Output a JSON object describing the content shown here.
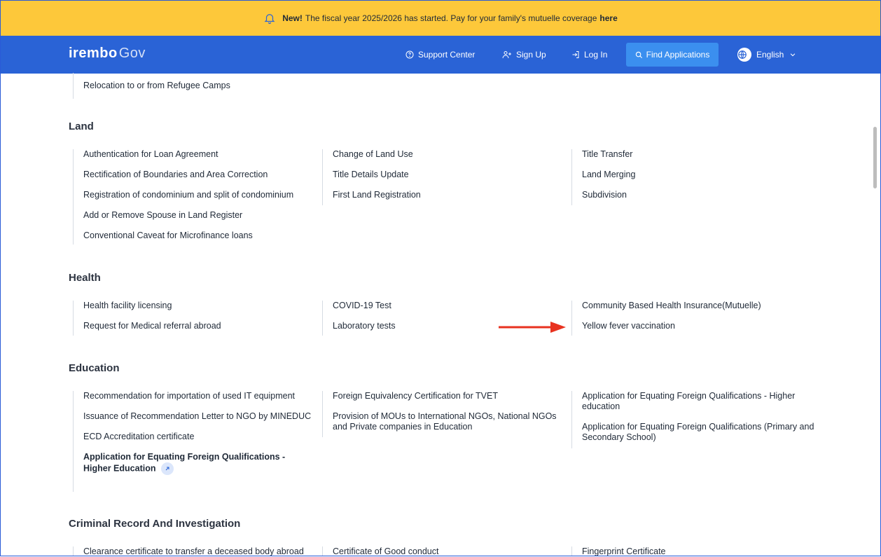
{
  "banner": {
    "new_label": "New!",
    "message": "The fiscal year 2025/2026 has started. Pay for your family's mutuelle coverage",
    "link_label": "here"
  },
  "nav": {
    "logo_main": "irembo",
    "logo_sub": "Gov",
    "support_label": "Support Center",
    "signup_label": "Sign Up",
    "login_label": "Log In",
    "find_label": "Find Applications",
    "language_label": "English"
  },
  "relocation": {
    "item": "Relocation to or from Refugee Camps"
  },
  "land": {
    "title": "Land",
    "col1": [
      "Authentication for Loan Agreement",
      "Rectification of Boundaries and Area Correction",
      "Registration of condominium and split of condominium",
      "Add or Remove Spouse in Land Register",
      "Conventional Caveat for Microfinance loans"
    ],
    "col2": [
      "Change of Land Use",
      "Title Details Update",
      "First Land Registration"
    ],
    "col3": [
      "Title Transfer",
      "Land Merging",
      "Subdivision"
    ]
  },
  "health": {
    "title": "Health",
    "col1": [
      "Health facility licensing",
      "Request for Medical referral abroad"
    ],
    "col2": [
      "COVID-19 Test",
      "Laboratory tests"
    ],
    "col3": [
      "Community Based Health Insurance(Mutuelle)",
      "Yellow fever vaccination"
    ]
  },
  "education": {
    "title": "Education",
    "col1": [
      "Recommendation for importation of used IT equipment",
      "Issuance of Recommendation Letter to NGO by MINEDUC",
      "ECD Accreditation certificate",
      "Application for Equating Foreign Qualifications - Higher Education"
    ],
    "col2": [
      "Foreign Equivalency Certification for TVET",
      "Provision of MOUs to International NGOs, National NGOs and Private companies in Education"
    ],
    "col3": [
      "Application for Equating Foreign Qualifications - Higher education",
      "Application for Equating Foreign Qualifications (Primary and Secondary School)"
    ]
  },
  "criminal": {
    "title": "Criminal Record And Investigation",
    "col1": [
      "Clearance certificate to transfer a deceased body abroad"
    ],
    "col2": [
      "Certificate of Good conduct"
    ],
    "col3": [
      "Fingerprint Certificate"
    ]
  },
  "colors": {
    "banner": "#fdc83a",
    "nav": "#2a63d6",
    "find_button": "#3b8fef",
    "arrow": "#e8321f"
  }
}
